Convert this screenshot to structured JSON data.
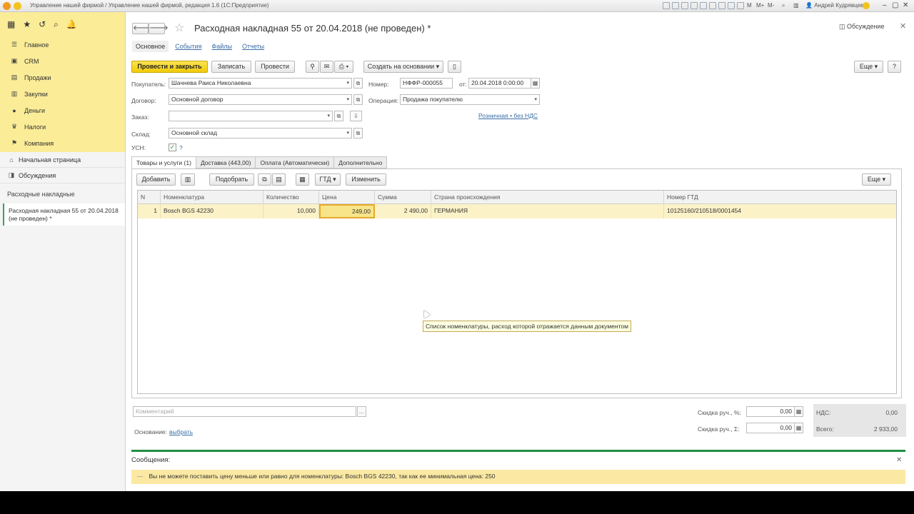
{
  "app": {
    "title": "Управление нашей фирмой / Управление нашей фирмой, редакция 1.6  (1С:Предприятие)",
    "user": "Андрей Кудрявцев",
    "quick": [
      "M",
      "M+",
      "M-"
    ]
  },
  "sidebar": {
    "main_items": [
      {
        "label": "Главное",
        "icon": "menu-icon"
      },
      {
        "label": "CRM",
        "icon": "crm-icon"
      },
      {
        "label": "Продажи",
        "icon": "sales-icon"
      },
      {
        "label": "Закупки",
        "icon": "purchases-icon"
      },
      {
        "label": "Деньги",
        "icon": "money-icon"
      },
      {
        "label": "Налоги",
        "icon": "taxes-icon"
      },
      {
        "label": "Компания",
        "icon": "company-icon"
      }
    ],
    "home": "Начальная страница",
    "discussions": "Обсуждения",
    "section": "Расходные накладные",
    "open_doc": "Расходная накладная 55 от 20.04.2018 (не проведен) *"
  },
  "doc": {
    "title": "Расходная накладная 55 от 20.04.2018 (не проведен) *",
    "discuss": "Обсуждение",
    "tabs": [
      "Основное",
      "События",
      "Файлы",
      "Отчеты"
    ],
    "toolbar": {
      "post_close": "Провести и закрыть",
      "save": "Записать",
      "post": "Провести",
      "create_based": "Создать на основании",
      "more": "Еще",
      "help": "?"
    },
    "fields": {
      "buyer_label": "Покупатель:",
      "buyer": "Шачнева Раиса Николаевна",
      "contract_label": "Договор:",
      "contract": "Основной договор",
      "order_label": "Заказ:",
      "order": "",
      "warehouse_label": "Склад:",
      "warehouse": "Основной склад",
      "usn_label": "УСН:",
      "usn_help": "?",
      "number_label": "Номер:",
      "number": "НФФР-000055",
      "from_label": "от:",
      "date": "20.04.2018  0:00:00",
      "operation_label": "Операция:",
      "operation": "Продажа покупателю",
      "price_link": "Розничная • без НДС"
    },
    "form_tabs": [
      "Товары и услуги (1)",
      "Доставка (443,00)",
      "Оплата (Автоматически)",
      "Дополнительно"
    ],
    "table_toolbar": {
      "add": "Добавить",
      "select": "Подобрать",
      "gtd": "ГТД",
      "change": "Изменить",
      "more": "Еще"
    },
    "table": {
      "columns": [
        "N",
        "Номенклатура",
        "Количество",
        "Цена",
        "Сумма",
        "Страна происхождения",
        "Номер ГТД"
      ],
      "rows": [
        {
          "n": "1",
          "item": "Bosch BGS 42230",
          "qty": "10,000",
          "price": "249,00",
          "sum": "2 490,00",
          "country": "ГЕРМАНИЯ",
          "gtd": "10125160/210518/0001454"
        }
      ]
    },
    "tooltip": "Список номенклатуры, расход которой отражается данным документом",
    "comment_placeholder": "Комментарий",
    "basis_label": "Основание:",
    "basis_link": "выбрать",
    "discount_pct_label": "Скидка руч., %:",
    "discount_pct": "0,00",
    "discount_sum_label": "Скидка руч., Σ:",
    "discount_sum": "0,00",
    "vat_label": "НДС:",
    "vat": "0,00",
    "total_label": "Всего:",
    "total": "2 933,00"
  },
  "messages": {
    "title": "Сообщения:",
    "items": [
      "Вы не можете поставить цену меньше или равно для номенклатуры: Bosch BGS 42230, так как ее минимальная цена: 250"
    ]
  },
  "colors": {
    "accent": "#f1cb09",
    "sidebar": "#fbec97",
    "message_bar": "#1f8f43",
    "selected_row": "#fcf2c8"
  }
}
